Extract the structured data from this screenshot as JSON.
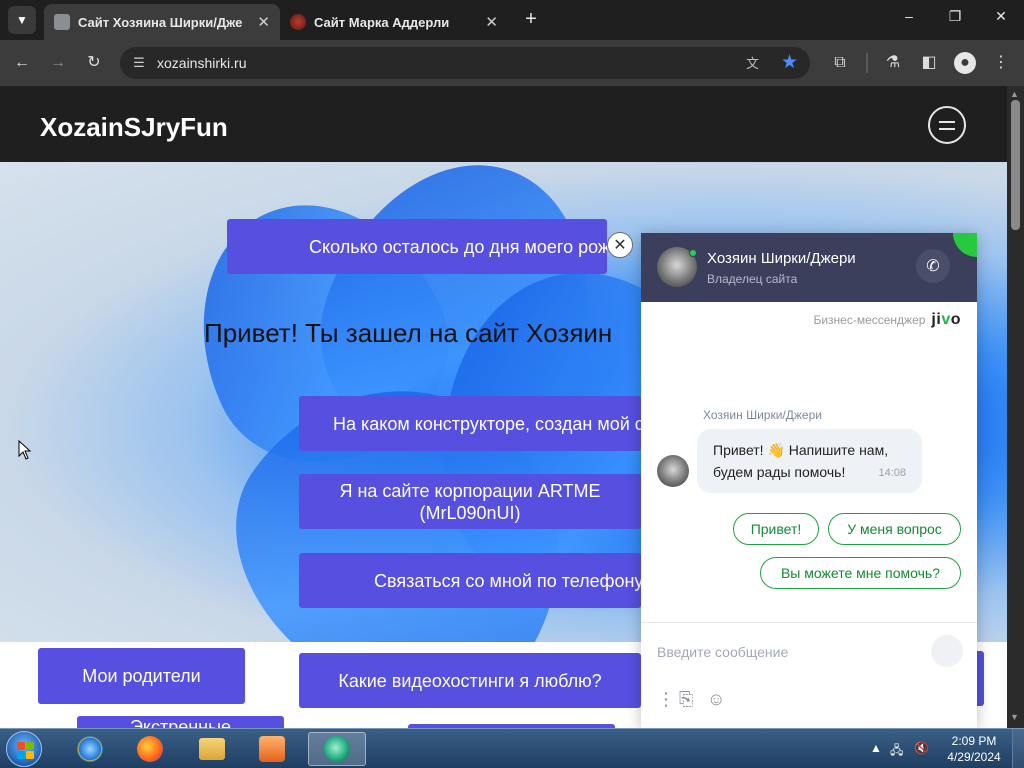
{
  "browser": {
    "tabs": [
      {
        "label": "Сайт Хозяина Ширки/Джери",
        "active": true
      },
      {
        "label": "Сайт Марка Аддерли",
        "active": false
      }
    ],
    "new_tab_symbol": "+",
    "close_symbol": "✕",
    "url": "xozainshirki.ru",
    "window_controls": {
      "minimize": "–",
      "restore": "❐",
      "close": "✕"
    }
  },
  "site": {
    "logo": "XozainSJryFun",
    "hero_title": "Привет! Ты зашел на сайт Хозяин",
    "buttons": {
      "birthday": "Сколько осталось до дня моего рож",
      "constructor": "На каком конструкторе, создан мой с",
      "artme_line1": "Я на сайте корпорации ARTME",
      "artme_line2": "(MrL090nUI)",
      "phone": "Связаться со мной по телефону",
      "parents": "Мои родители",
      "videohosting": "Какие видеохостинги я люблю?",
      "emergency": "Экстренные"
    }
  },
  "chat": {
    "agent_name": "Хозяин Ширки/Джери",
    "agent_role": "Владелец сайта",
    "brand_text": "Бизнес-мессенджер",
    "brand_logo_a": "ji",
    "brand_logo_b": "v",
    "brand_logo_c": "o",
    "message_sender": "Хозяин Ширки/Джери",
    "message_line1": "Привет! 👋 Напишите нам,",
    "message_line2": "будем рады помочь!",
    "message_time": "14:08",
    "quick_replies": [
      "Привет!",
      "У меня вопрос",
      "Вы можете мне помочь?"
    ],
    "input_placeholder": "Введите сообщение",
    "close_symbol": "✕"
  },
  "taskbar": {
    "time": "2:09 PM",
    "date": "4/29/2024"
  },
  "colors": {
    "accent_purple": "#564fe0",
    "chat_header": "#3c3f5c",
    "chat_green": "#22a046",
    "bookmark_star": "#4f8cf5"
  }
}
